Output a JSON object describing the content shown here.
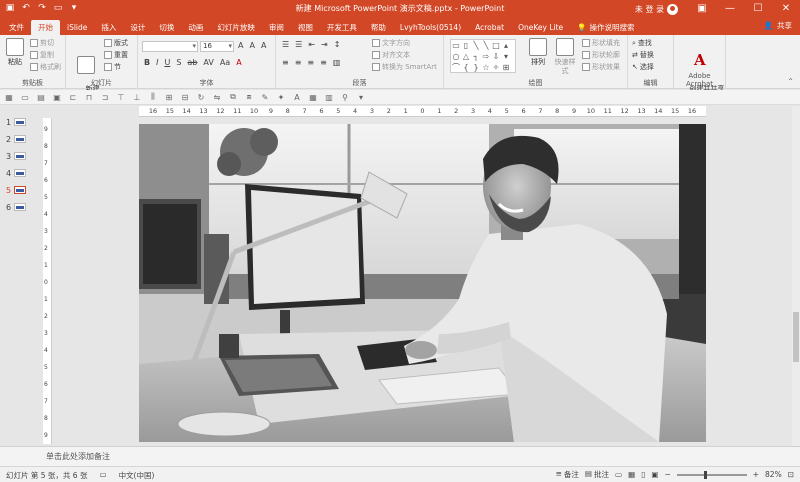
{
  "title": "新建 Microsoft PowerPoint 演示文稿.pptx  -  PowerPoint",
  "user": {
    "name": "未 登 录"
  },
  "tabs": [
    "文件",
    "开始",
    "iSlide",
    "插入",
    "设计",
    "切换",
    "动画",
    "幻灯片放映",
    "审阅",
    "视图",
    "开发工具",
    "帮助",
    "LvyhTools(0514)",
    "Acrobat",
    "OneKey Lite"
  ],
  "active_tab": "开始",
  "tell_me": "操作说明搜索",
  "share": "共享",
  "ribbon": {
    "clipboard": {
      "paste": "粘贴",
      "cut": "剪切",
      "copy": "复制",
      "format_painter": "格式刷",
      "label": "剪贴板"
    },
    "slides": {
      "new_slide": "新建\n幻灯片",
      "layout": "版式",
      "reset": "重置",
      "section": "节",
      "label": "幻灯片"
    },
    "font": {
      "label": "字体",
      "font_name": "",
      "font_size": "16"
    },
    "paragraph": {
      "label": "段落",
      "text_direction": "文字方向",
      "align_text": "对齐文本",
      "smartart": "转换为 SmartArt"
    },
    "drawing": {
      "label": "绘图",
      "arrange": "排列",
      "quick_styles": "快速样式",
      "shape_fill": "形状填充",
      "shape_outline": "形状轮廓",
      "shape_effects": "形状效果"
    },
    "editing": {
      "label": "编辑",
      "find": "查找",
      "replace": "替换",
      "select": "选择"
    },
    "acrobat": {
      "label": "Adobe Acrobat",
      "create_share": "创建并共享\nAdobe PDF"
    }
  },
  "slides": [
    "1",
    "2",
    "3",
    "4",
    "5",
    "6"
  ],
  "active_slide": "5",
  "hruler_ticks": [
    "16",
    "15",
    "14",
    "13",
    "12",
    "11",
    "10",
    "9",
    "8",
    "7",
    "6",
    "5",
    "4",
    "3",
    "2",
    "1",
    "0",
    "1",
    "2",
    "3",
    "4",
    "5",
    "6",
    "7",
    "8",
    "9",
    "10",
    "11",
    "12",
    "13",
    "14",
    "15",
    "16"
  ],
  "vruler_ticks": [
    "9",
    "8",
    "7",
    "6",
    "5",
    "4",
    "3",
    "2",
    "1",
    "0",
    "1",
    "2",
    "3",
    "4",
    "5",
    "6",
    "7",
    "8",
    "9"
  ],
  "notes_placeholder": "单击此处添加备注",
  "status": {
    "slide_info": "幻灯片 第 5 张，共 6 张",
    "language": "中文(中国)",
    "notes": "备注",
    "comments": "批注",
    "zoom": "82%"
  },
  "zoom_level": 0.82,
  "colors": {
    "accent": "#d24726"
  }
}
